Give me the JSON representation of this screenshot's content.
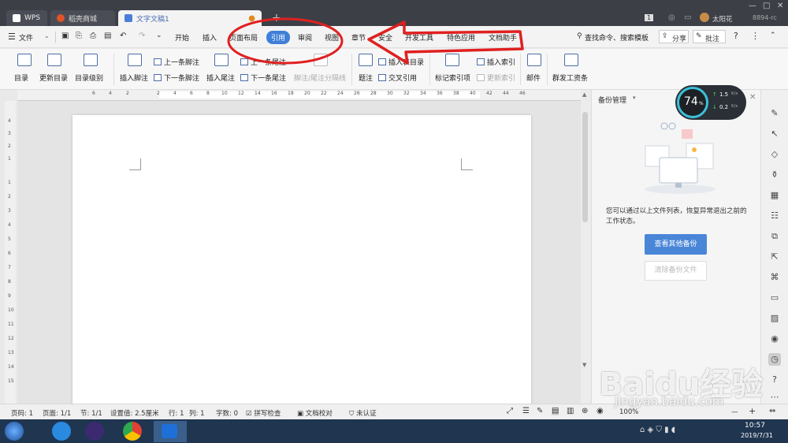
{
  "tabs": [
    {
      "label": "WPS"
    },
    {
      "label": "稻壳商城"
    },
    {
      "label": "文字文稿1"
    }
  ],
  "top_right": {
    "badge": "1",
    "username": "太阳花",
    "code": "8894-rc"
  },
  "menu": {
    "file": "文件",
    "items": [
      "开始",
      "插入",
      "页面布局",
      "引用",
      "审阅",
      "视图",
      "章节",
      "安全",
      "开发工具",
      "特色应用",
      "文档助手"
    ],
    "search": "查找命令、搜索模板",
    "share": "分享",
    "comment": "批注"
  },
  "ribbon": {
    "toc": "目录",
    "update_toc": "更新目录",
    "toc_level": "目录级别",
    "insert_footnote": "插入脚注",
    "prev_footnote": "上一条脚注",
    "next_footnote": "下一条脚注",
    "insert_endnote": "插入尾注",
    "prev_endnote": "上一条尾注",
    "next_endnote": "下一条尾注",
    "note_sep": "脚注/尾注分隔线",
    "caption": "题注",
    "insert_table_toc": "插入表目录",
    "cross_ref": "交叉引用",
    "mark_index": "标记索引项",
    "insert_index": "插入索引",
    "update_index": "更新索引",
    "mail": "邮件",
    "send_docs": "群发工资条"
  },
  "ruler_h": [
    "6",
    "4",
    "2",
    "2",
    "4",
    "6",
    "8",
    "10",
    "12",
    "14",
    "16",
    "18",
    "20",
    "22",
    "24",
    "26",
    "28",
    "30",
    "32",
    "34",
    "36",
    "38",
    "40",
    "42",
    "44",
    "46"
  ],
  "ruler_v": [
    "4",
    "3",
    "2",
    "1",
    "1",
    "2",
    "3",
    "4",
    "5",
    "6",
    "7",
    "8",
    "9",
    "10",
    "11",
    "12",
    "13",
    "14",
    "15"
  ],
  "panel": {
    "title": "备份管理",
    "desc": "您可以通过以上文件列表，恢复异常退出之前的工作状态。",
    "view_btn": "查看其他备份",
    "clear_btn": "清除备份文件",
    "speed_pct": "74",
    "speed_unit": "%",
    "up": "1.5",
    "down": "0.2",
    "speed_rate_unit": "K/s"
  },
  "status": {
    "page": "页码: 1",
    "pages": "页面: 1/1",
    "section": "节: 1/1",
    "setting": "设置值: 2.5厘米",
    "row": "行: 1",
    "col": "列: 1",
    "words": "字数: 0",
    "spell": "拼写检查",
    "proof": "文档校对",
    "unverified": "未认证",
    "zoom": "100%"
  },
  "taskbar": {
    "time": "10:57",
    "date": "2019/7/31"
  },
  "watermark": "Baidu经验",
  "watermark_url": "jingyan.baidu.com",
  "colors": {
    "accent": "#3f7fd8",
    "annotation": "#e02020",
    "tabbar": "#3c3f46"
  }
}
